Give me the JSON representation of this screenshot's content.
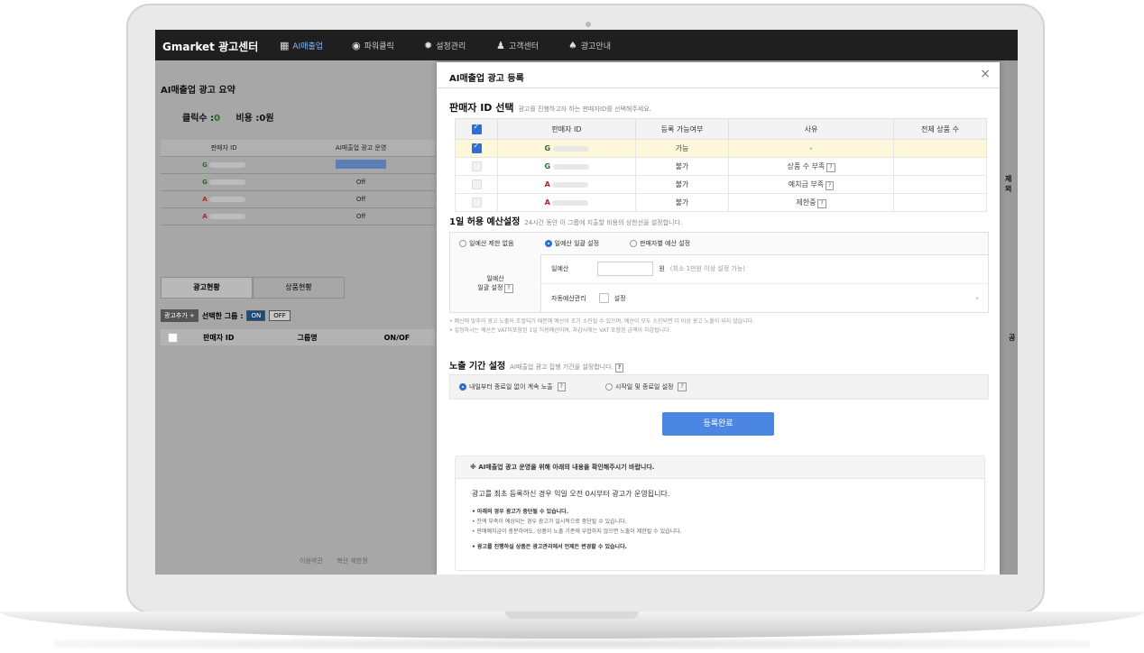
{
  "topnav": {
    "brand": "Gmarket 광고센터",
    "items": [
      {
        "label": "AI매출업",
        "icon": "calendar-icon",
        "active": true
      },
      {
        "label": "파워클릭",
        "icon": "mouse-icon"
      },
      {
        "label": "설정관리",
        "icon": "gear-icon"
      },
      {
        "label": "고객센터",
        "icon": "person-icon"
      },
      {
        "label": "광고안내",
        "icon": "bell-icon"
      }
    ]
  },
  "background": {
    "title": "AI매출업 광고 요약",
    "summary": {
      "clicks_label": "클릭수 :",
      "clicks_value": "0",
      "cost_label": "비용 :",
      "cost_value": "0원"
    },
    "table": {
      "headers": [
        "판매자 ID",
        "AI매출업 광고 운영"
      ],
      "rows": [
        {
          "prefix": "G",
          "status": ""
        },
        {
          "prefix": "G",
          "status": "Off"
        },
        {
          "prefix": "A",
          "status": "Off"
        },
        {
          "prefix": "A",
          "status": "Off"
        }
      ]
    },
    "tabs": [
      "광고현황",
      "상품현황"
    ],
    "ctrl": {
      "add_btn": "광고추가 +",
      "selected_label": "선택한 그룹 :",
      "on": "ON",
      "off": "OFF"
    },
    "list_headers": [
      "판매자 ID",
      "그룹명",
      "ON/OF"
    ],
    "footer": {
      "a": "이용약관",
      "b": "복산 제한정"
    },
    "right_a": "제외",
    "right_b": "공"
  },
  "modal": {
    "title": "AI매출업 광고 등록",
    "close": "×",
    "seller_section": {
      "title": "판매자 ID 선택",
      "hint": "광고를 진행하고자 하는 판매자ID를 선택해주세요."
    },
    "seller_table": {
      "headers": [
        "판매자 ID",
        "등록 가능여부",
        "사유",
        "전체 상품 수"
      ],
      "rows": [
        {
          "prefix": "G",
          "avail": "가능",
          "reason": "-",
          "checked": true,
          "help": false
        },
        {
          "prefix": "G",
          "avail": "불가",
          "reason": "상품 수 부족",
          "checked": false,
          "help": true
        },
        {
          "prefix": "A",
          "avail": "불가",
          "reason": "예치금 부족",
          "checked": false,
          "help": true
        },
        {
          "prefix": "A",
          "avail": "불가",
          "reason": "제한중",
          "checked": false,
          "help": true
        }
      ]
    },
    "budget_section": {
      "title": "1일 허용 예산설정",
      "hint": "24시간 동안 이 그룹에 지출할 비용의 상한선을 설정합니다.",
      "radios": [
        "일예산 제한 없음",
        "일예산 일괄 설정",
        "판매자별 예산 설정"
      ],
      "label_l1": "일예산",
      "label_l2": "일괄 설정",
      "daily_label": "일예산",
      "unit": "원",
      "unit_hint": "(최소 1만원 이상 설정 가능)",
      "auto_label": "자동예산관리",
      "auto_check": "설정",
      "note1": "• 예산에 맞추어 광고 노출이 조절되기 때문에 예산이 조기 소진될 수 있으며, 예산이 모두 소진되면 더 이상 광고 노출이 되지 않습니다.",
      "note2": "• 설정하시는 예산은 VAT미포함된 1일 허용예산이며, 차감시에는 VAT 포함된 금액이 차감됩니다."
    },
    "period_section": {
      "title": "노출 기간 설정",
      "hint": "AI매출업 광고 집행 기간을 설정합니다.",
      "opt1": "내일부터 종료일 없이 계속 노출",
      "opt2": "시작일 및 종료일 설정"
    },
    "submit": "등록완료",
    "notice": {
      "head": "※ AI매출업 광고 운영을 위해 아래의 내용을 확인해주시기 바랍니다.",
      "main": "광고를 최초 등록하신 경우 익일 오전 0시부터 광고가 운영됩니다.",
      "l1": "• 아래의 경우 광고가 중단될 수 있습니다.",
      "l2": "• 잔액 부족이 예상되는 경우 광고가 일시적으로 중단될 수 있습니다.",
      "l3": "• 판매예치금이 충분하여도, 상품이 노출 기준에 부합하지 않으면 노출이 제한될 수 있습니다.",
      "l4": "• 광고를 진행하실 상품은 광고관리에서 언제든 변경할 수 있습니다."
    }
  }
}
